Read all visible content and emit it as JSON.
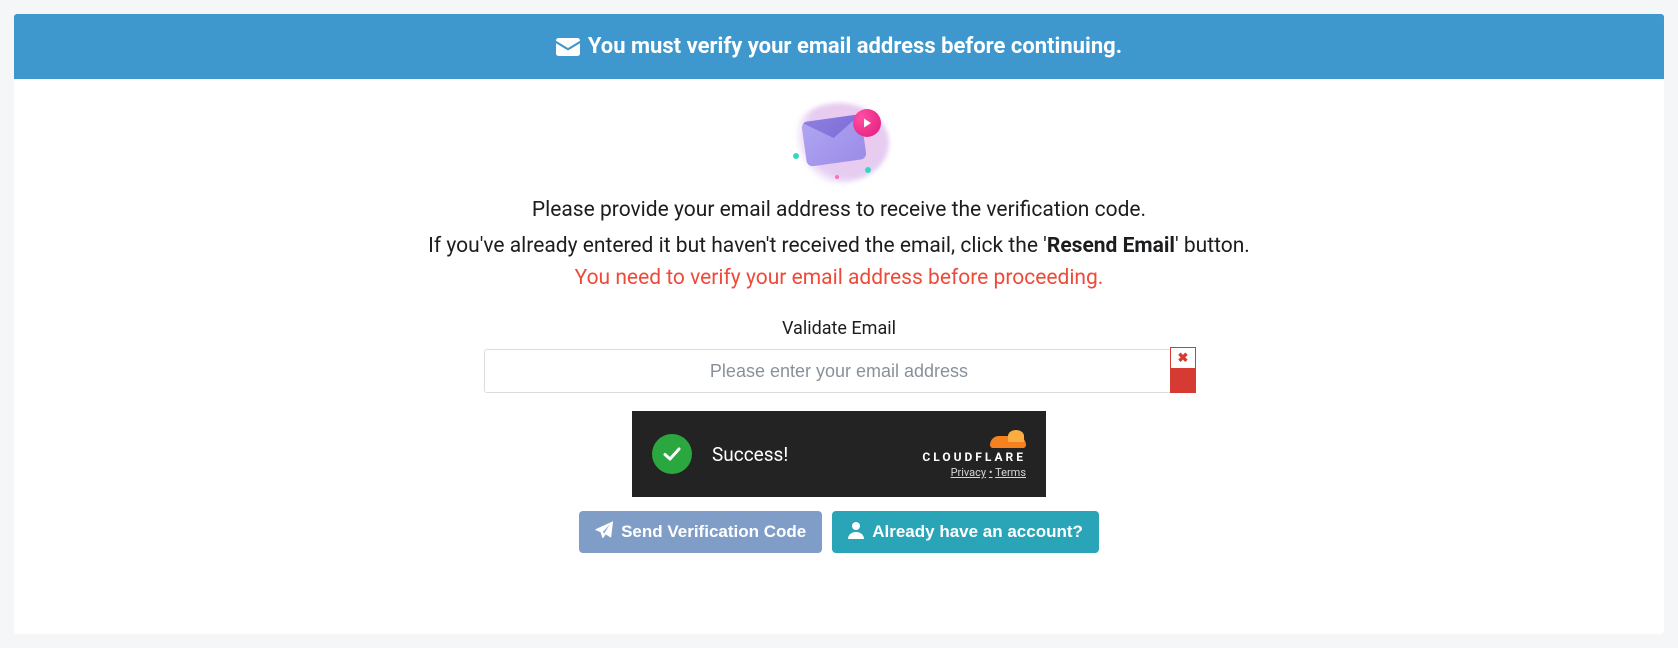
{
  "banner": {
    "text": "You must verify your email address before continuing."
  },
  "instructions": {
    "line1": "Please provide your email address to receive the verification code.",
    "line2_pre": "If you've already entered it but haven't received the email, click the '",
    "line2_strong": "Resend Email",
    "line2_post": "' button.",
    "warning": "You need to verify your email address before proceeding."
  },
  "form": {
    "label": "Validate Email",
    "placeholder": "Please enter your email address",
    "value": ""
  },
  "captcha": {
    "status": "Success!",
    "provider": "CLOUDFLARE",
    "privacy": "Privacy",
    "sep": "•",
    "terms": "Terms"
  },
  "buttons": {
    "send": "Send Verification Code",
    "existing": "Already have an account?"
  }
}
